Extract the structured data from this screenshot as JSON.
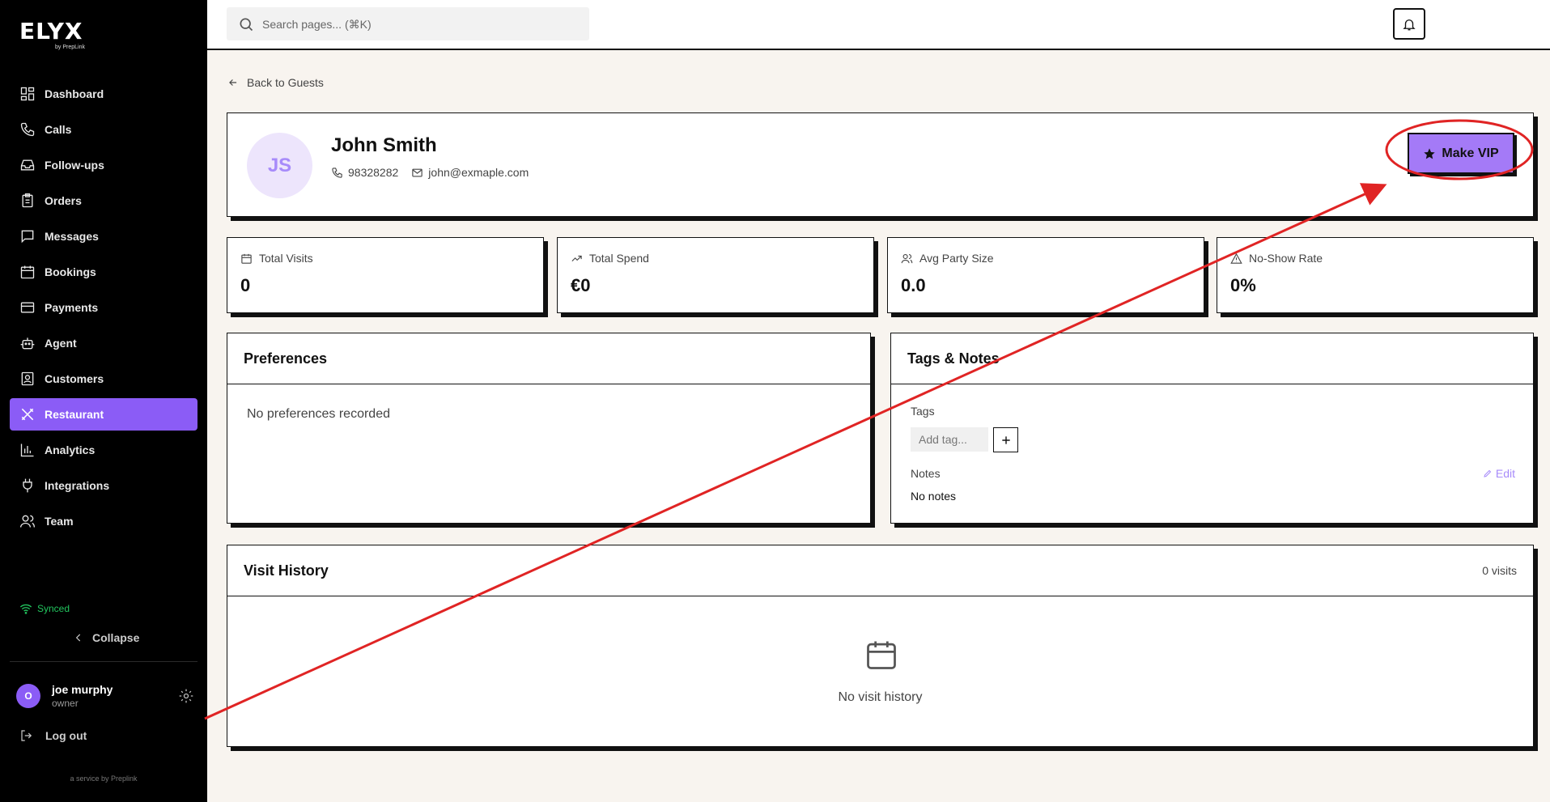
{
  "app": {
    "logo": "ELYX",
    "logo_sub": "by PrepLink",
    "service_note": "a service by Preplink"
  },
  "sidebar": {
    "items": [
      {
        "label": "Dashboard",
        "icon": "dashboard-icon"
      },
      {
        "label": "Calls",
        "icon": "phone-icon"
      },
      {
        "label": "Follow-ups",
        "icon": "inbox-icon"
      },
      {
        "label": "Orders",
        "icon": "clipboard-icon"
      },
      {
        "label": "Messages",
        "icon": "message-icon"
      },
      {
        "label": "Bookings",
        "icon": "calendar-icon"
      },
      {
        "label": "Payments",
        "icon": "credit-card-icon"
      },
      {
        "label": "Agent",
        "icon": "bot-icon"
      },
      {
        "label": "Customers",
        "icon": "contact-icon"
      },
      {
        "label": "Restaurant",
        "icon": "utensils-icon",
        "active": true
      },
      {
        "label": "Analytics",
        "icon": "bar-chart-icon"
      },
      {
        "label": "Integrations",
        "icon": "plug-icon"
      },
      {
        "label": "Team",
        "icon": "users-icon"
      }
    ],
    "status": "Synced",
    "collapse_label": "Collapse",
    "user": {
      "initial": "O",
      "name": "joe murphy",
      "role": "owner"
    },
    "logout_label": "Log out"
  },
  "topbar": {
    "search_placeholder": "Search pages... (⌘K)"
  },
  "back_link": "Back to Guests",
  "guest": {
    "initials": "JS",
    "name": "John Smith",
    "phone": "98328282",
    "email": "john@exmaple.com",
    "vip_label": "Make VIP"
  },
  "stats": [
    {
      "label": "Total Visits",
      "value": "0",
      "icon": "calendar-icon"
    },
    {
      "label": "Total Spend",
      "value": "€0",
      "icon": "trending-up-icon"
    },
    {
      "label": "Avg Party Size",
      "value": "0.0",
      "icon": "users-icon"
    },
    {
      "label": "No-Show Rate",
      "value": "0%",
      "icon": "warning-icon"
    }
  ],
  "preferences": {
    "title": "Preferences",
    "empty": "No preferences recorded"
  },
  "tags_notes": {
    "title": "Tags & Notes",
    "tags_label": "Tags",
    "tag_placeholder": "Add tag...",
    "notes_label": "Notes",
    "edit_label": "Edit",
    "notes_value": "No notes"
  },
  "visit_history": {
    "title": "Visit History",
    "count": "0 visits",
    "empty": "No visit history"
  },
  "colors": {
    "accent": "#8b5cf6",
    "vip_button": "#a47af7",
    "synced": "#22c55e",
    "annotation": "#e02424"
  }
}
